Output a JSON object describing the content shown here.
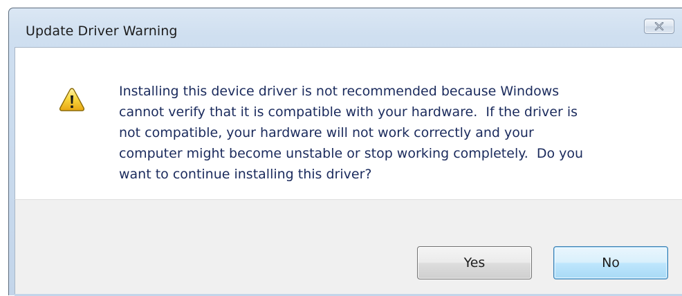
{
  "window": {
    "title": "Update Driver Warning",
    "close_icon": "close-icon"
  },
  "message": {
    "icon": "warning-icon",
    "lines": [
      "Installing this device driver is not recommended because Windows",
      "cannot verify that it is compatible with your hardware.  If the driver is",
      "not compatible, your hardware will not work correctly and your",
      "computer might become unstable or stop working completely.  Do you",
      "want to continue installing this driver?"
    ]
  },
  "buttons": {
    "yes_label": "Yes",
    "no_label": "No"
  },
  "colors": {
    "message_text": "#1a2a5c",
    "warning_fill": "#f5cf2a",
    "default_button_border": "#3c7fb1"
  }
}
